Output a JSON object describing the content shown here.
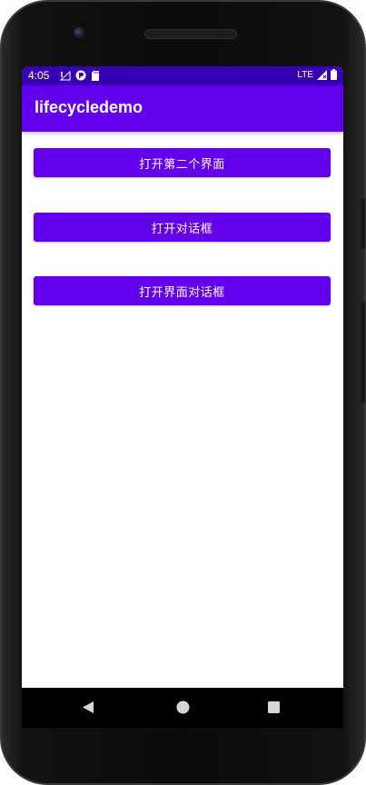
{
  "status_bar": {
    "time": "4:05",
    "network_label": "LTE",
    "bar_color": "#3700b3"
  },
  "app_bar": {
    "title": "lifecycledemo",
    "color": "#6200ee"
  },
  "buttons": [
    {
      "label": "打开第二个界面"
    },
    {
      "label": "打开对话框"
    },
    {
      "label": "打开界面对话框"
    }
  ],
  "navigation": {
    "back_icon": "back-triangle-icon",
    "home_icon": "home-circle-icon",
    "recents_icon": "recents-square-icon"
  }
}
